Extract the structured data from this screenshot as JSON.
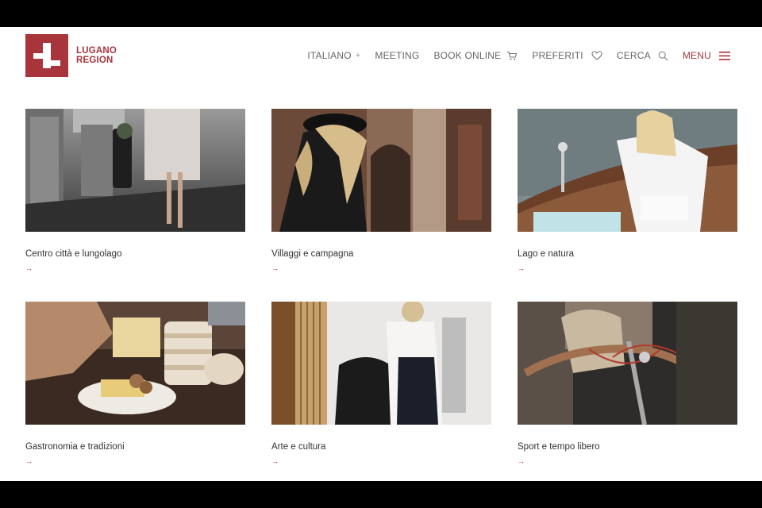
{
  "brand": {
    "line1": "LUGANO",
    "line2": "REGION",
    "color": "#a8343c"
  },
  "nav": {
    "language": "ITALIANO",
    "language_toggle": "+",
    "meeting": "MEETING",
    "book_online": "BOOK ONLINE",
    "favorites": "PREFERITI",
    "search": "CERCA",
    "menu": "MENU"
  },
  "cards": [
    {
      "label": "Centro città e lungolago",
      "arrow": "→"
    },
    {
      "label": "Villaggi e campagna",
      "arrow": "→"
    },
    {
      "label": "Lago e natura",
      "arrow": "→"
    },
    {
      "label": "Gastronomia e tradizioni",
      "arrow": "→"
    },
    {
      "label": "Arte e cultura",
      "arrow": "→"
    },
    {
      "label": "Sport e tempo libero",
      "arrow": "→"
    }
  ],
  "icons": [
    "cart-icon",
    "heart-icon",
    "search-icon",
    "hamburger-menu-icon"
  ]
}
